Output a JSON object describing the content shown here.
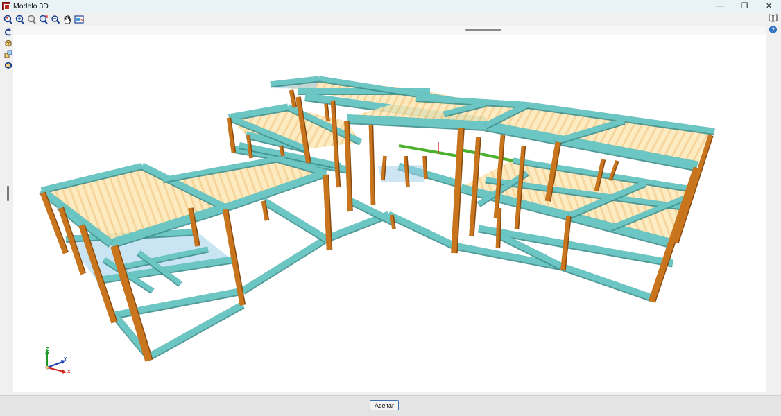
{
  "window": {
    "title": "Modelo 3D",
    "min_symbol": "—",
    "restore_symbol": "❐",
    "close_symbol": "✕"
  },
  "toolbar": {
    "items": [
      {
        "icon": "rotate-view-icon"
      },
      {
        "icon": "orbit-icon"
      },
      {
        "icon": "zoom-window-icon"
      },
      {
        "icon": "refresh-view-icon"
      },
      {
        "icon": "zoom-icon"
      },
      {
        "icon": "pan-hand-icon"
      },
      {
        "icon": "display-options-icon"
      }
    ]
  },
  "side_toolbar": {
    "items": [
      {
        "icon": "rotate-arrow-icon"
      },
      {
        "icon": "cube-icon"
      },
      {
        "icon": "cubes-icon"
      },
      {
        "icon": "render-icon"
      }
    ]
  },
  "right_toolbar": {
    "items": [
      {
        "icon": "book-icon"
      },
      {
        "icon": "help-icon"
      }
    ]
  },
  "footer": {
    "accept_label": "Aceitar"
  },
  "axes": {
    "x_label": "X",
    "y_label": "Y",
    "z_label": "Z"
  },
  "colors": {
    "beam": "#6cc7c4",
    "beam_dark": "#3f8f8d",
    "column": "#c8751e",
    "column_dark": "#8a4b10",
    "slab": "#fde3a8",
    "slab_stripe": "#f2c57a",
    "glass": "#9dcde9",
    "green_beam": "#4cb22e"
  }
}
